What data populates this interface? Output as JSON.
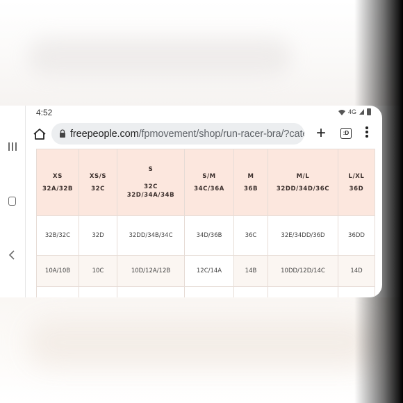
{
  "status_bar": {
    "time": "4:52",
    "network": "4G",
    "icons": [
      "wifi-icon",
      "signal-icon",
      "battery-icon"
    ]
  },
  "browser": {
    "url_domain": "freepeople.com",
    "url_path": "/fpmovement/shop/run-racer-bra/?category=S",
    "new_tab_label": "+",
    "tab_count_label": ":D"
  },
  "size_table": {
    "header": [
      {
        "size": "XS",
        "fits": "32A/32B"
      },
      {
        "size": "XS/S",
        "fits": "32C"
      },
      {
        "size": "S",
        "fits": "32C\n32D/34A/34B"
      },
      {
        "size": "S/M",
        "fits": "34C/36A"
      },
      {
        "size": "M",
        "fits": "36B"
      },
      {
        "size": "M/L",
        "fits": "32DD/34D/36C"
      },
      {
        "size": "L/XL",
        "fits": "36D"
      }
    ],
    "rows": [
      [
        "32B/32C",
        "32D",
        "32DD/34B/34C",
        "34D/36B",
        "36C",
        "32E/34DD/36D",
        "36DD"
      ],
      [
        "10A/10B",
        "10C",
        "10D/12A/12B",
        "12C/14A",
        "14B",
        "10DD/12D/14C",
        "14D"
      ]
    ]
  },
  "colors": {
    "header_bg": "#fce7de",
    "alt_row_bg": "#fbf6f2",
    "url_bar_bg": "#eceef0"
  }
}
